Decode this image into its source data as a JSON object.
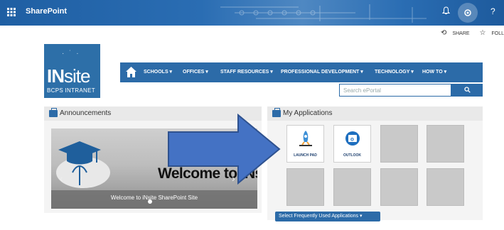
{
  "suitebar": {
    "waffle_icon": "app-launcher-icon",
    "title": "SharePoint",
    "help": "?"
  },
  "share_bar": {
    "share_label": "SHARE",
    "follow_label": "FOLL"
  },
  "logo": {
    "main_bold": "IN",
    "main_rest": "site",
    "subtitle": "BCPS INTRANET"
  },
  "nav": {
    "items": [
      {
        "label": "SCHOOLS ▾"
      },
      {
        "label": "OFFICES ▾"
      },
      {
        "label": "STAFF RESOURCES ▾"
      },
      {
        "label": "PROFESSIONAL DEVELOPMENT ▾"
      },
      {
        "label": "TECHNOLOGY ▾"
      },
      {
        "label": "HOW TO ▾"
      }
    ]
  },
  "search": {
    "placeholder": "Search ePortal",
    "button_icon": "search-icon"
  },
  "announcements": {
    "title": "Announcements",
    "slide_title": "Welcome to iNsite",
    "caption": "Welcome to iNsite SharePoint Site",
    "prev": "‹",
    "next": "›"
  },
  "applications": {
    "title": "My Applications",
    "tiles": [
      {
        "label": "LAUNCH PAD",
        "icon": "rocket-icon"
      },
      {
        "label": "OUTLOOK",
        "icon": "outlook-icon"
      }
    ],
    "select_button": "Select Frequently Used Applications ▾"
  },
  "colors": {
    "brand_blue": "#2c6ba8",
    "suitebar_blue": "#1f5fa3",
    "arrow_fill": "#4472c4"
  }
}
